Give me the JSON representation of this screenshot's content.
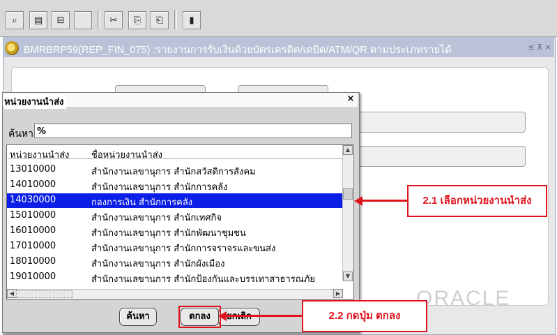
{
  "toolbar": {
    "buttons": [
      {
        "name": "query-icon",
        "glyph": "⌕"
      },
      {
        "name": "print-icon",
        "glyph": "▤"
      },
      {
        "name": "print-setup-icon",
        "glyph": "⊟"
      },
      {
        "name": "blank-button",
        "glyph": ""
      },
      {
        "name": "cut-icon",
        "glyph": "✂"
      },
      {
        "name": "copy-icon",
        "glyph": "⎘"
      },
      {
        "name": "paste-icon",
        "glyph": "⎗"
      },
      {
        "name": "exit-icon",
        "glyph": "▮"
      }
    ]
  },
  "main_window": {
    "title": "BMRBRP59(REP_FIN_075) :รายงานการรับเงินด้วยบัตรเครดิต/เดบิต/ATM/QR ตามประเภทรายได้",
    "controls": "≤ ⊼ ×"
  },
  "oracle_logo": "ORACLE",
  "dialog": {
    "title": "หน่วยงานนำส่ง",
    "close": "×",
    "search_label": "ค้นหา",
    "search_value": "%",
    "columns": [
      "หน่วยงานนำส่ง",
      "ชื่อหน่วยงานนำส่ง"
    ],
    "rows": [
      {
        "code": "13010000",
        "name": "สำนักงานเลขานุการ สำนักสวัสดิการสังคม"
      },
      {
        "code": "14010000",
        "name": "สำนักงานเลขานุการ สำนักการคลัง"
      },
      {
        "code": "14030000",
        "name": "กองการเงิน สำนักการคลัง"
      },
      {
        "code": "15010000",
        "name": "สำนักงานเลขานุการ สำนักเทศกิจ"
      },
      {
        "code": "16010000",
        "name": "สำนักงานเลขานุการ สำนักพัฒนาชุมชน"
      },
      {
        "code": "17010000",
        "name": "สำนักงานเลขานุการ สำนักการจราจรและขนส่ง"
      },
      {
        "code": "18010000",
        "name": "สำนักงานเลขานุการ สำนักผังเมือง"
      },
      {
        "code": "19010000",
        "name": "สำนักงานเลขานุการ สำนักป้องกันและบรรเทาสาธารณภัย"
      }
    ],
    "selected_index": 2,
    "buttons": {
      "find": "ค้นหา",
      "ok": "ตกลง",
      "cancel": "ยกเลิก"
    }
  },
  "annotations": {
    "step1": "2.1 เลือกหน่วยงานนำส่ง",
    "step2": "2.2 กดปุ่ม ตกลง",
    "color": "#e0141e"
  }
}
